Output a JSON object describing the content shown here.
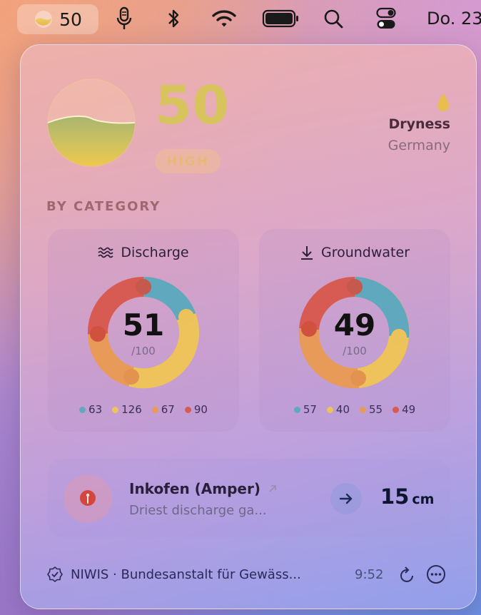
{
  "menubar": {
    "status_value": "50",
    "date": "Do. 23"
  },
  "panel": {
    "index_value": "50",
    "index_level": "HIGH",
    "index_fraction": 0.5,
    "metric": "Dryness",
    "region": "Germany",
    "section_title": "BY CATEGORY",
    "categories": [
      {
        "label": "Discharge",
        "icon": "waves-icon",
        "value": "51",
        "max_label": "/100",
        "legend": [
          "63",
          "126",
          "67",
          "90"
        ]
      },
      {
        "label": "Groundwater",
        "icon": "arrow-down-to-line-icon",
        "value": "49",
        "max_label": "/100",
        "legend": [
          "57",
          "40",
          "55",
          "49"
        ]
      }
    ],
    "station": {
      "name": "Inkofen (Amper)",
      "description": "Driest discharge ga...",
      "level_value": "15",
      "level_unit": "cm"
    },
    "footer": {
      "source": "NIWIS · Bundesanstalt für Gewäss...",
      "time": "9:52"
    }
  },
  "colors": {
    "teal": "#5fa8bd",
    "yellow": "#e8c25c",
    "orange": "#e59a58",
    "red": "#d65a50",
    "accent": "#d8c45c"
  },
  "icons": [
    "microphone-icon",
    "bluetooth-icon",
    "wifi-icon",
    "battery-icon",
    "search-icon",
    "control-center-icon",
    "drop-icon",
    "pin-icon",
    "arrow-right-icon",
    "external-link-icon",
    "verified-badge-icon",
    "refresh-icon",
    "more-icon"
  ]
}
